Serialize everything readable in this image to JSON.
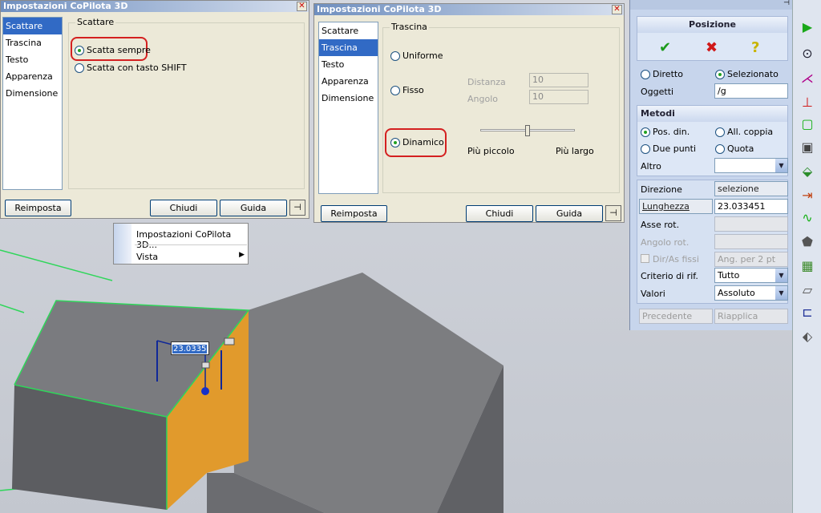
{
  "dialog1": {
    "title": "Impostazioni CoPilota 3D",
    "nav": [
      "Scattare",
      "Trascina",
      "Testo",
      "Apparenza",
      "Dimensione"
    ],
    "group_label": "Scattare",
    "radio_always": "Scatta sempre",
    "radio_shift": "Scatta con tasto SHIFT",
    "btn_reset": "Reimposta",
    "btn_close": "Chiudi",
    "btn_help": "Guida"
  },
  "dialog2": {
    "title": "Impostazioni CoPilota 3D",
    "nav": [
      "Scattare",
      "Trascina",
      "Testo",
      "Apparenza",
      "Dimensione"
    ],
    "group_label": "Trascina",
    "radio_uniform": "Uniforme",
    "radio_fixed": "Fisso",
    "radio_dynamic": "Dinamico",
    "distance_label": "Distanza",
    "distance_value": "10",
    "angle_label": "Angolo",
    "angle_value": "10",
    "smaller_label": "Più piccolo",
    "larger_label": "Più largo",
    "btn_reset": "Reimposta",
    "btn_close": "Chiudi",
    "btn_help": "Guida"
  },
  "context_menu": {
    "item1": "Impostazioni CoPilota 3D...",
    "item2": "Vista"
  },
  "viewport": {
    "dimension_value": "23.0335"
  },
  "panel": {
    "title": "Posizione",
    "radio_direct": "Diretto",
    "radio_selected": "Selezionato",
    "objects_label": "Oggetti",
    "objects_value": "/g",
    "methods_title": "Metodi",
    "m_posdin": "Pos. din.",
    "m_allcoppia": "All. coppia",
    "m_duepunti": "Due punti",
    "m_quota": "Quota",
    "altro_label": "Altro",
    "direzione_label": "Direzione",
    "direzione_value": "selezione",
    "lunghezza_label": "Lunghezza",
    "lunghezza_value": "23.033451",
    "asse_label": "Asse rot.",
    "angolo_label": "Angolo rot.",
    "dirfissi_label": "Dir/As fissi",
    "dirfissi_value": "Ang. per 2 pt",
    "criterio_label": "Criterio di rif.",
    "criterio_value": "Tutto",
    "valori_label": "Valori",
    "valori_value": "Assoluto",
    "btn_prev": "Precedente",
    "btn_reapply": "Riapplica"
  },
  "colors": {
    "accent": "#316ac5",
    "highlight": "#d42020",
    "face_orange": "#e19a2c",
    "edge_green": "#2fd65a"
  }
}
